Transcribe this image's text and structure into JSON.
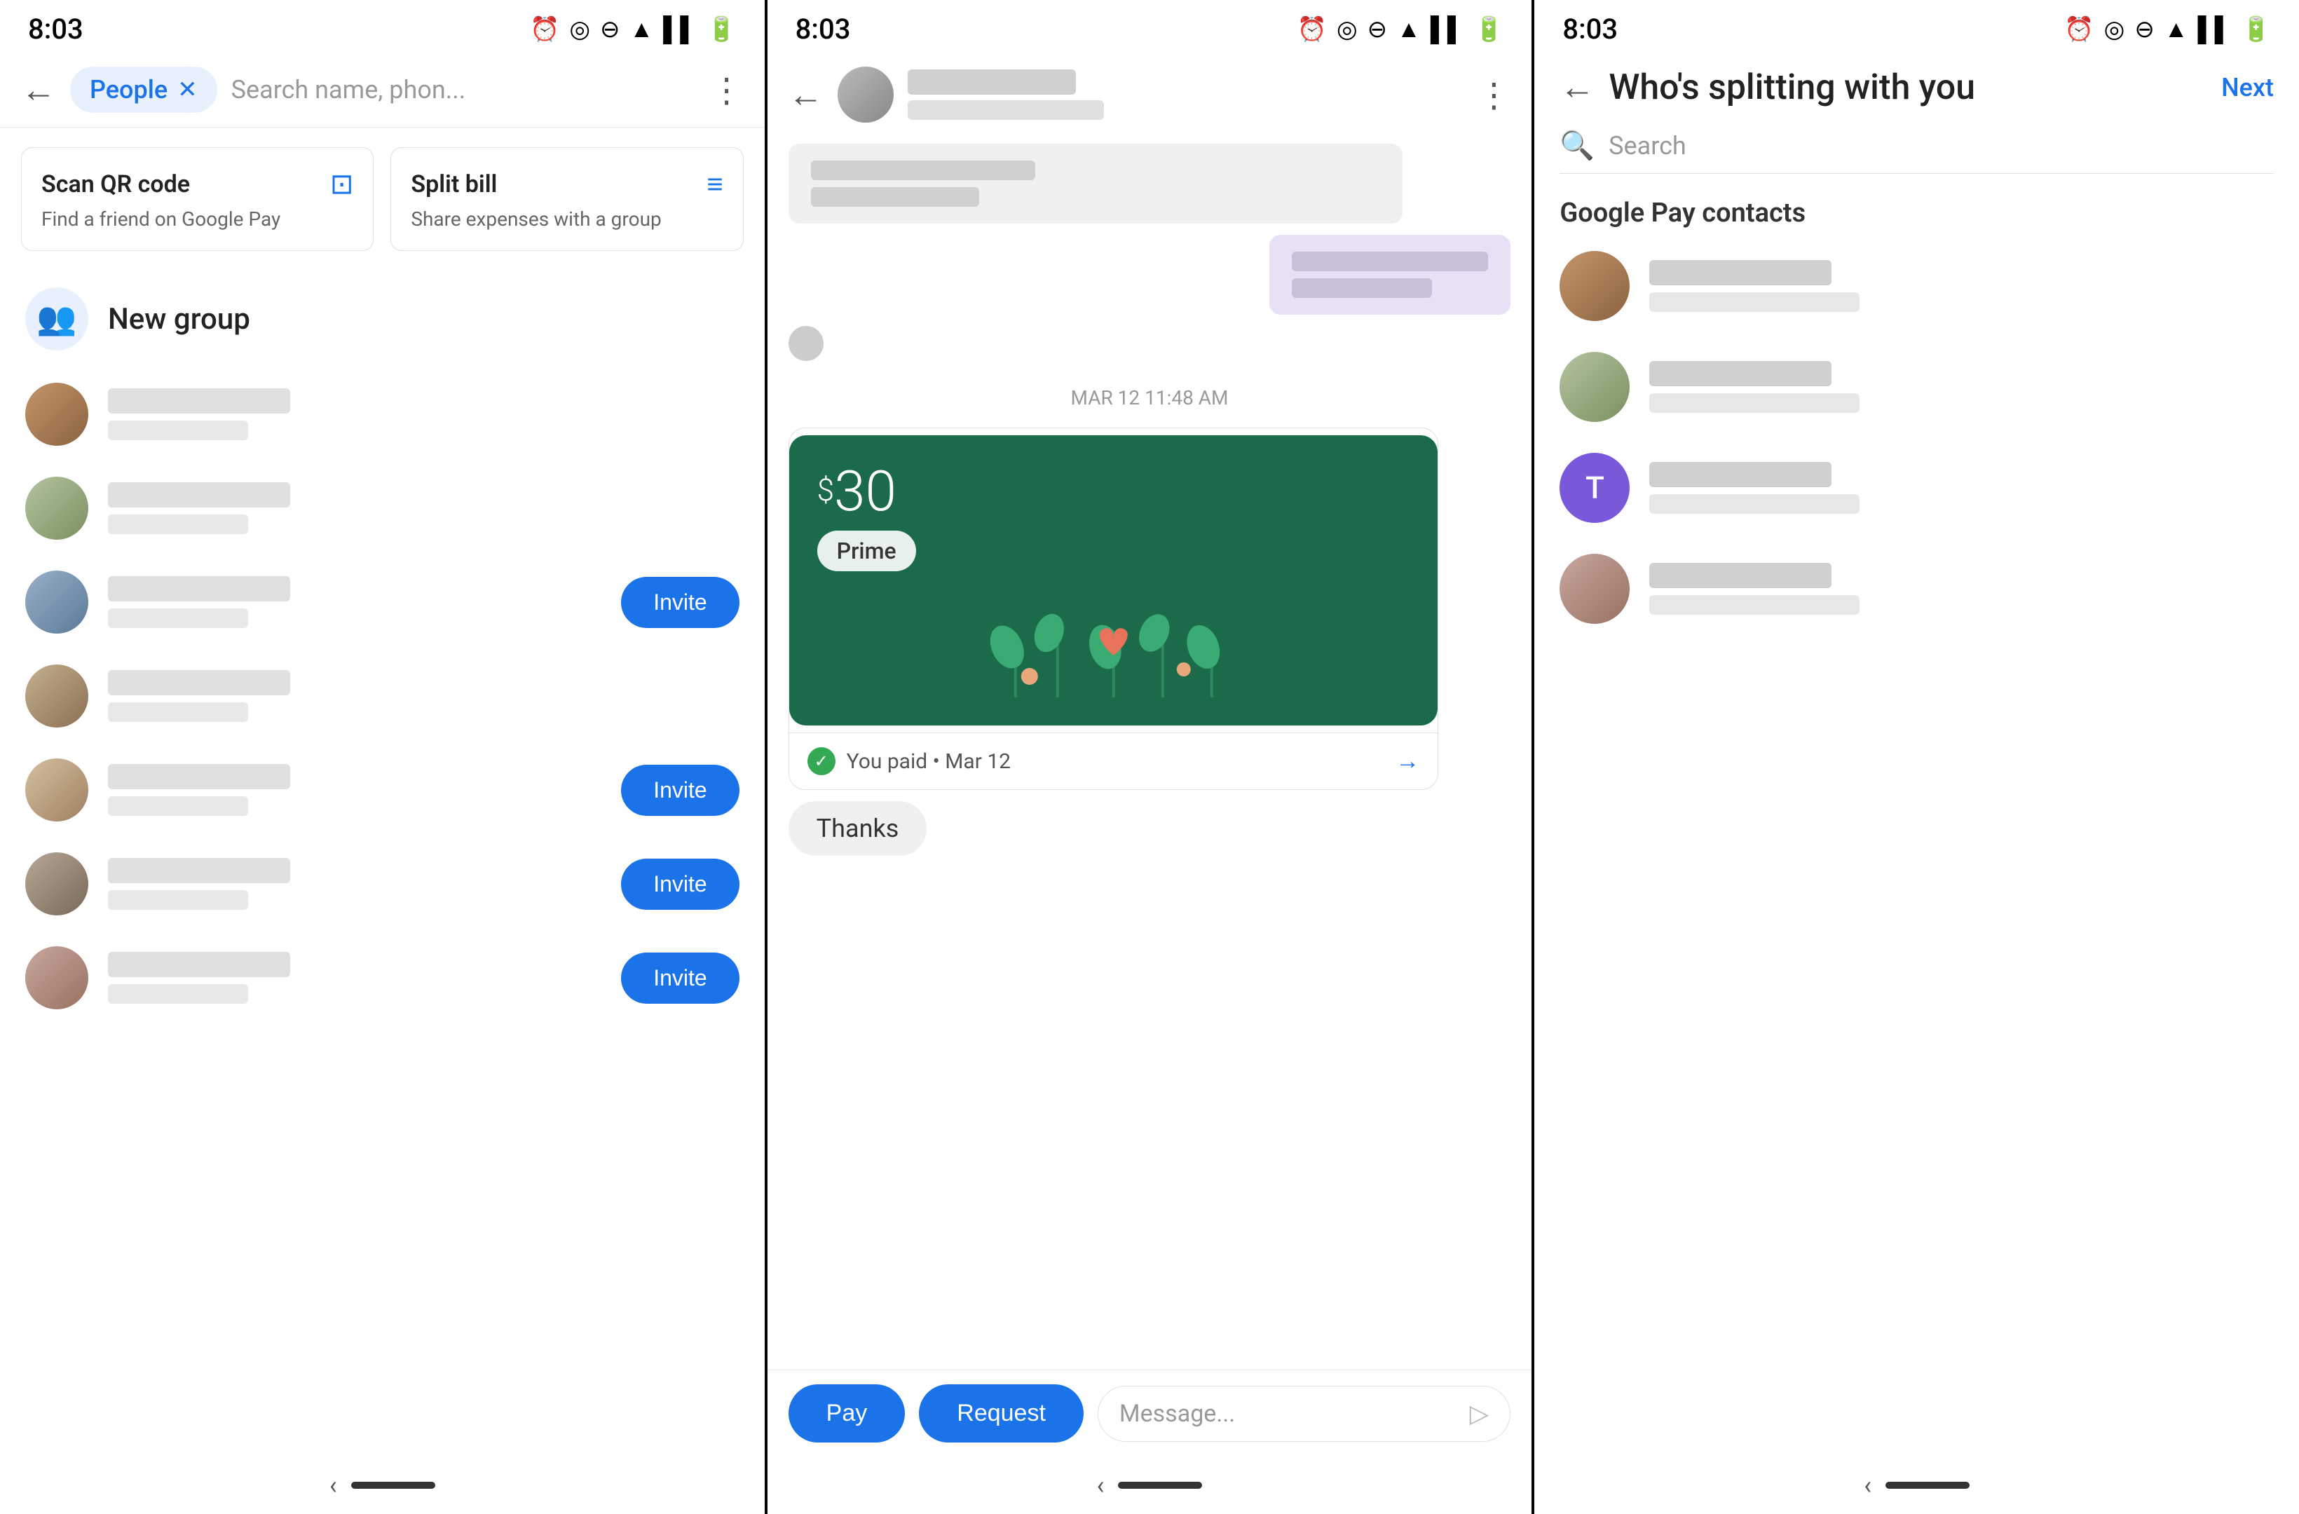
{
  "panels": {
    "panel1": {
      "status_time": "8:03",
      "back_label": "←",
      "chip_label": "People",
      "search_placeholder": "Search name, phon...",
      "actions": [
        {
          "title": "Scan QR code",
          "desc": "Find a friend on Google Pay",
          "icon": "📷"
        },
        {
          "title": "Split bill",
          "desc": "Share expenses with a group",
          "icon": "≡"
        }
      ],
      "new_group_label": "New group",
      "contacts": [
        {
          "has_invite": false
        },
        {
          "has_invite": false
        },
        {
          "has_invite": true
        },
        {
          "has_invite": false
        },
        {
          "has_invite": true
        },
        {
          "has_invite": true
        },
        {
          "has_invite": true
        }
      ],
      "invite_label": "Invite"
    },
    "panel2": {
      "status_time": "8:03",
      "back_label": "←",
      "chat_date": "MAR 12 11:48 AM",
      "payment": {
        "amount": "30",
        "currency": "$",
        "badge": "Prime",
        "footer_text": "You paid • Mar 12"
      },
      "thanks_text": "Thanks",
      "pay_btn": "Pay",
      "request_btn": "Request",
      "message_placeholder": "Message..."
    },
    "panel3": {
      "status_time": "8:03",
      "back_label": "←",
      "title": "Who's splitting with you",
      "next_label": "Next",
      "search_placeholder": "Search",
      "section_title": "Google Pay contacts",
      "contacts": [
        {
          "initial": ""
        },
        {
          "initial": ""
        },
        {
          "initial": "T",
          "is_purple": true
        },
        {
          "initial": ""
        }
      ]
    }
  }
}
